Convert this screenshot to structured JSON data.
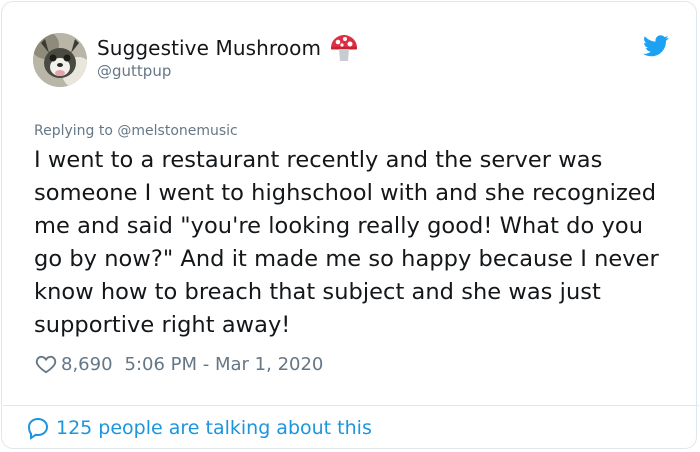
{
  "author": {
    "name": "Suggestive Mushroom",
    "handle": "@guttpup",
    "emoji": "mushroom"
  },
  "tweet": {
    "replying_prefix": "Replying to ",
    "replying_to": "@melstonemusic",
    "text": "I went to a restaurant recently and the server was someone I went to highschool with and she recognized me and said \"you're looking really good! What do you go by now?\" And it made me so happy because I never know how to breach that subject and she was just supportive right away!",
    "likes": "8,690",
    "timestamp": "5:06 PM - Mar 1, 2020"
  },
  "footer": {
    "talking": "125 people are talking about this"
  },
  "icons": {
    "brand": "twitter-bird-icon",
    "like": "heart-icon",
    "conversation": "speech-bubble-icon"
  },
  "colors": {
    "twitter_blue": "#1da1f2",
    "link_blue": "#1b95e0",
    "muted_gray": "#657786",
    "text_black": "#14171a",
    "border": "#e1e8ed"
  }
}
